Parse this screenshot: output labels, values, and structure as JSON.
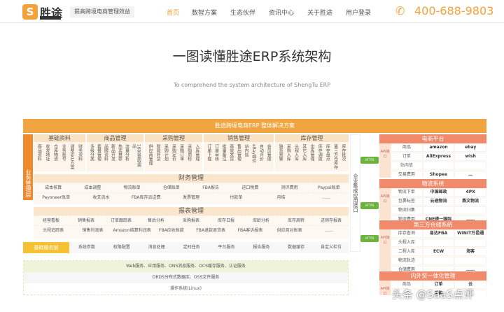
{
  "header": {
    "logo_text": "S",
    "brand": "胜途",
    "slogan": "提高跨境电商管理效益",
    "nav": [
      "首页",
      "数智方案",
      "生态伙伴",
      "资讯中心",
      "关于胜途",
      "用户登录"
    ],
    "phone": "400-688-9803"
  },
  "title": "一图读懂胜途ERP系统架构",
  "subtitle": "To comprehend the system architecture of ShengTu ERP",
  "banner": "胜途跨境电商ERP 整体解决方案",
  "biz_layer": "业务管理层",
  "modules": [
    {
      "name": "基础资料",
      "items": [
        "商品资料",
        "收发地址",
        "仓库物流",
        "业务账号",
        "调整SKU方案",
        "财务资料"
      ]
    },
    {
      "name": "商品管理",
      "items": [
        "多级分类",
        "套餐管理",
        "品牌资料",
        "新品开发",
        "热卖推荐",
        "流量分析",
        "1688提取商品"
      ]
    },
    {
      "name": "采购管理",
      "items": [
        "供应商管理",
        "智能补货",
        "采购计划",
        "采购定价",
        "采购订单",
        "采购质检",
        "入库管理"
      ]
    },
    {
      "name": "销售管理",
      "items": [
        "订单下载",
        "订单审核",
        "批量备注",
        "高效发货",
        "售后管理",
        "站内信",
        "eBay邮件",
        "自动评价",
        "会员管理"
      ]
    },
    {
      "name": "库存管理",
      "items": [
        "缺货预警",
        "采购入库",
        "头程入库",
        "其它入库",
        "出库管理",
        "库存调拨",
        "库存盘点",
        "第三方仓库存",
        "库存批次"
      ]
    }
  ],
  "finance": {
    "name": "财务管理",
    "rows": [
      [
        "成本核算",
        "成本调整",
        "物流账单",
        "仓储账单",
        "FBA报告",
        "进口税费",
        "测评费用",
        "Paypal账单"
      ],
      [
        "Payoneer账单",
        "收支流水",
        "FBA库存派送费",
        "发票管理",
        "付款单",
        "月结",
        "……"
      ]
    ]
  },
  "reports": {
    "name": "报表管理",
    "rows": [
      [
        "经营看板",
        "销售报表",
        "订单跟踪表",
        "售后分析",
        "采购报表",
        "库存日报",
        "库龄分析",
        "库存周转",
        "进销存报表"
      ],
      [
        "头程追踪表",
        "销售利润表",
        "Amazon结算利润表",
        "FBA应收账款",
        "FBA退款退货表",
        "FBA客诉报表",
        "供应商对账表",
        "……"
      ]
    ]
  },
  "basic_services": {
    "label": "基础服务层",
    "items": [
      "系统参数",
      "权限配置",
      "消息处理",
      "定时任务",
      "平台服务",
      "报告服务",
      "数据缓存",
      "自定义栏位"
    ]
  },
  "infra": [
    "Web服务、应用服务、ONS消息服务、OCS缓存服务、认证服务",
    "DRDS分布式数据库、OSS文件服务",
    "操作系统(Linux)"
  ],
  "integration": "企业集成应用接口",
  "arrow_label": "HTTPS",
  "api_label": "API接口",
  "right": [
    {
      "name": "电商平台",
      "rows": [
        [
          "商品",
          "amazon",
          "ebay"
        ],
        [
          "订单",
          "AliExpress",
          "wish"
        ],
        [
          "站内信",
          "",
          ""
        ],
        [
          "交易费用",
          "Shopee",
          "…"
        ]
      ]
    },
    {
      "name": "物流系统",
      "rows": [
        [
          "物流下单",
          "中国邮政",
          "4PX"
        ],
        [
          "包裹标签",
          "云途物流",
          "燕文物流"
        ],
        [
          "物流归集",
          "",
          ""
        ],
        [
          "物流费用",
          "CNE递一国际",
          "……"
        ]
      ]
    },
    {
      "name": "第三方仓储系统",
      "rows": [
        [
          "库存查询",
          "易达FBA",
          "WINIT万邑通"
        ],
        [
          "头程入库",
          "",
          ""
        ],
        [
          "二程入库",
          "ECW",
          "海客"
        ],
        [
          "物流轨迹",
          "",
          ""
        ],
        [
          "仓储费用",
          "",
          "……"
        ]
      ]
    },
    {
      "name": "内外贸一体化管理",
      "rows": [
        [
          "商品",
          "订单",
          "云"
        ],
        [
          "",
          "采购",
          ""
        ]
      ]
    }
  ],
  "watermark": "头条 @SaaS点评"
}
